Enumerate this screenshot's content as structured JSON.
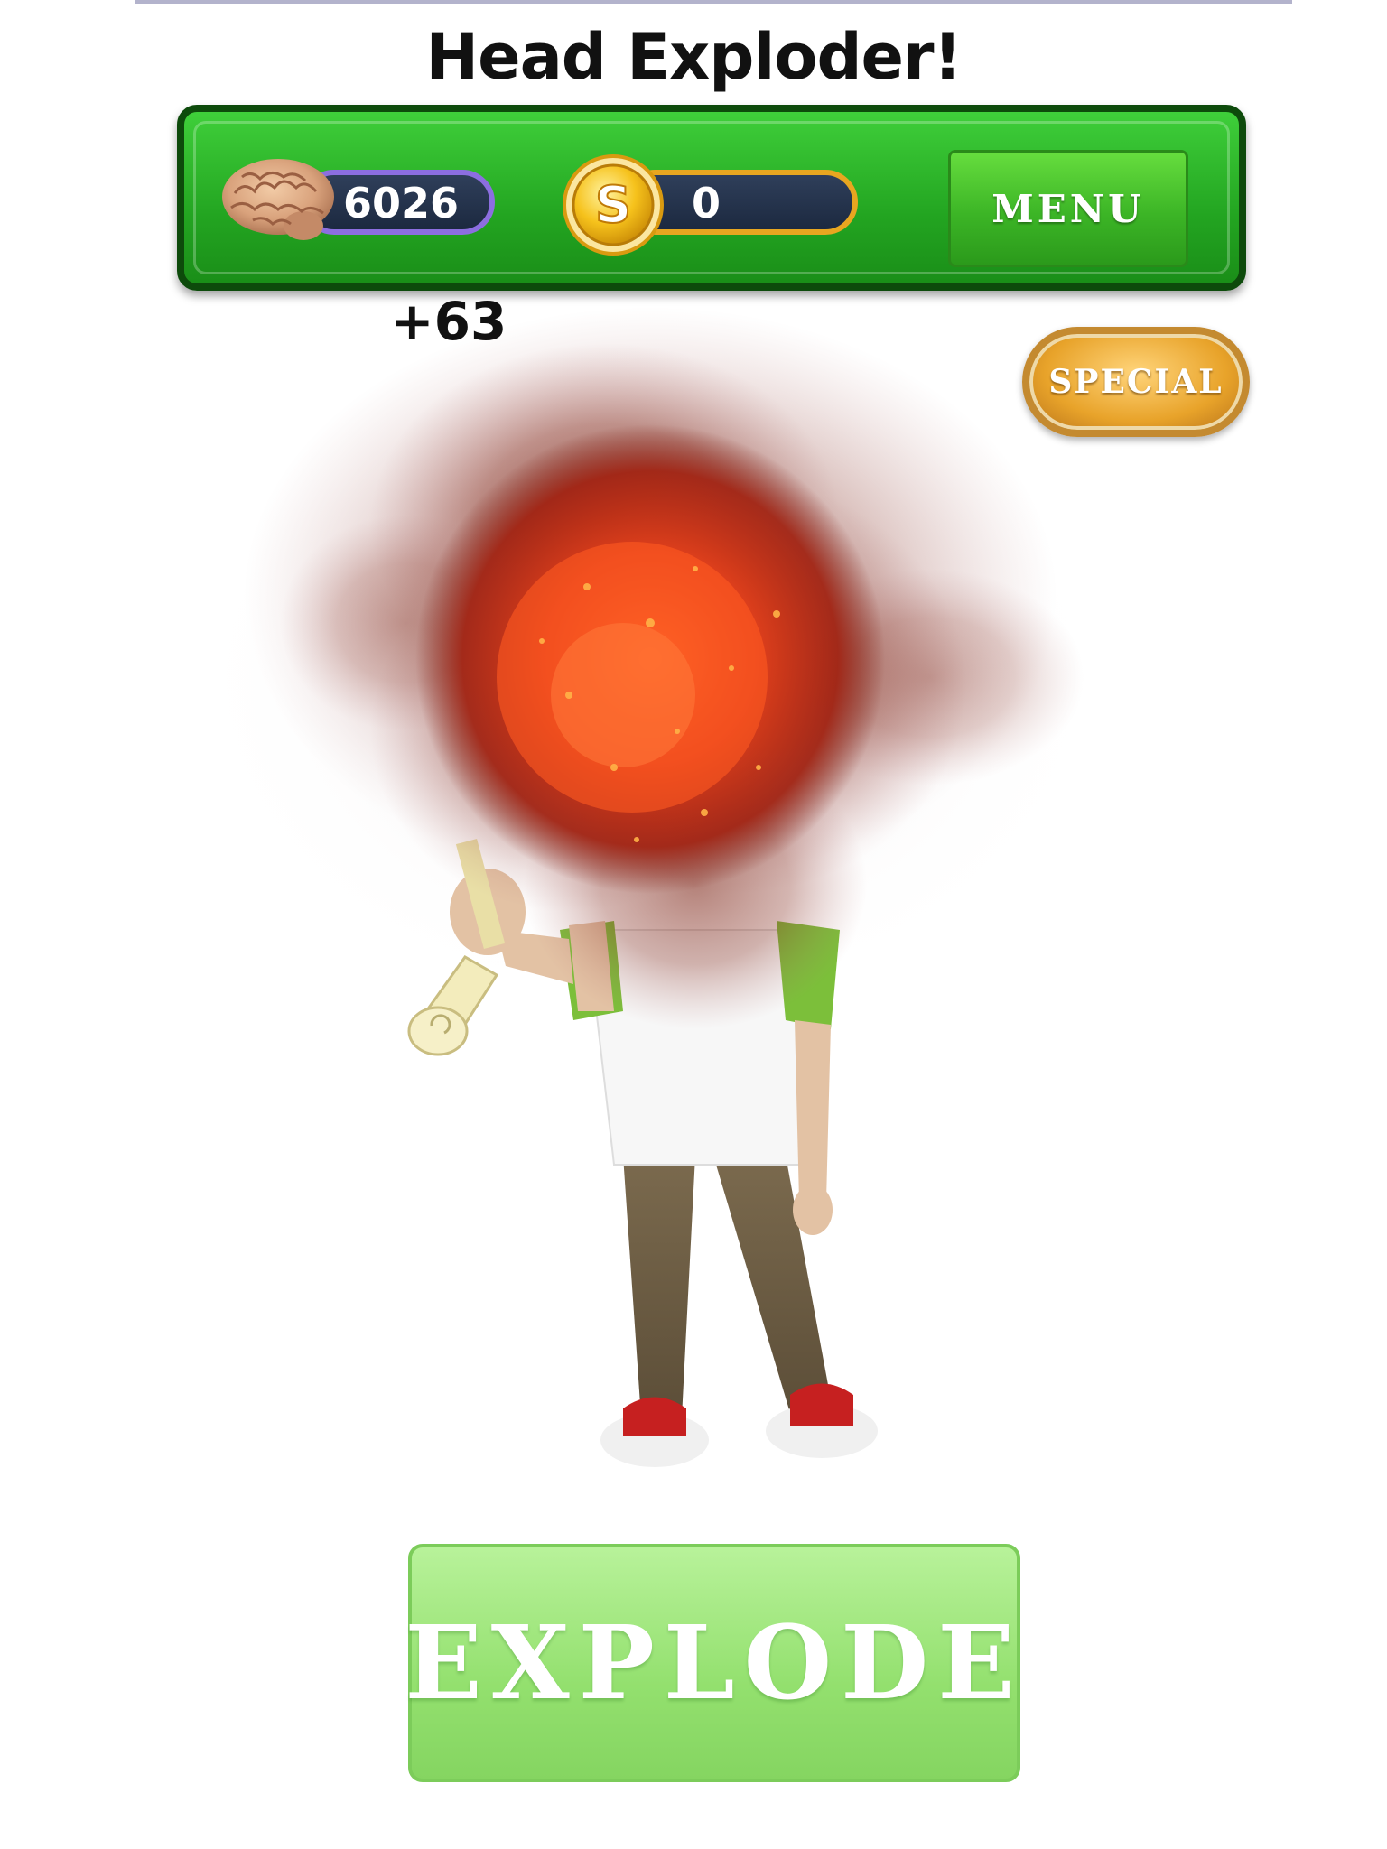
{
  "title": "Head Exploder!",
  "hud": {
    "brains": "6026",
    "coins": "0",
    "menu_label": "MENU",
    "brain_icon": "brain-icon",
    "coin_icon": "coin-icon",
    "coin_symbol": "S"
  },
  "score_pop": "+63",
  "special_label": "SPECIAL",
  "explode_label": "EXPLODE",
  "colors": {
    "hud_green": "#23a521",
    "hud_border": "#0d4a0b",
    "menu_green": "#3cb526",
    "special_gold": "#e8a32a",
    "explode_green": "#93e06e",
    "brain_pill_border": "#8c6ee0",
    "coin_pill_border": "#e8a620",
    "explosion_red": "#c0391b"
  }
}
